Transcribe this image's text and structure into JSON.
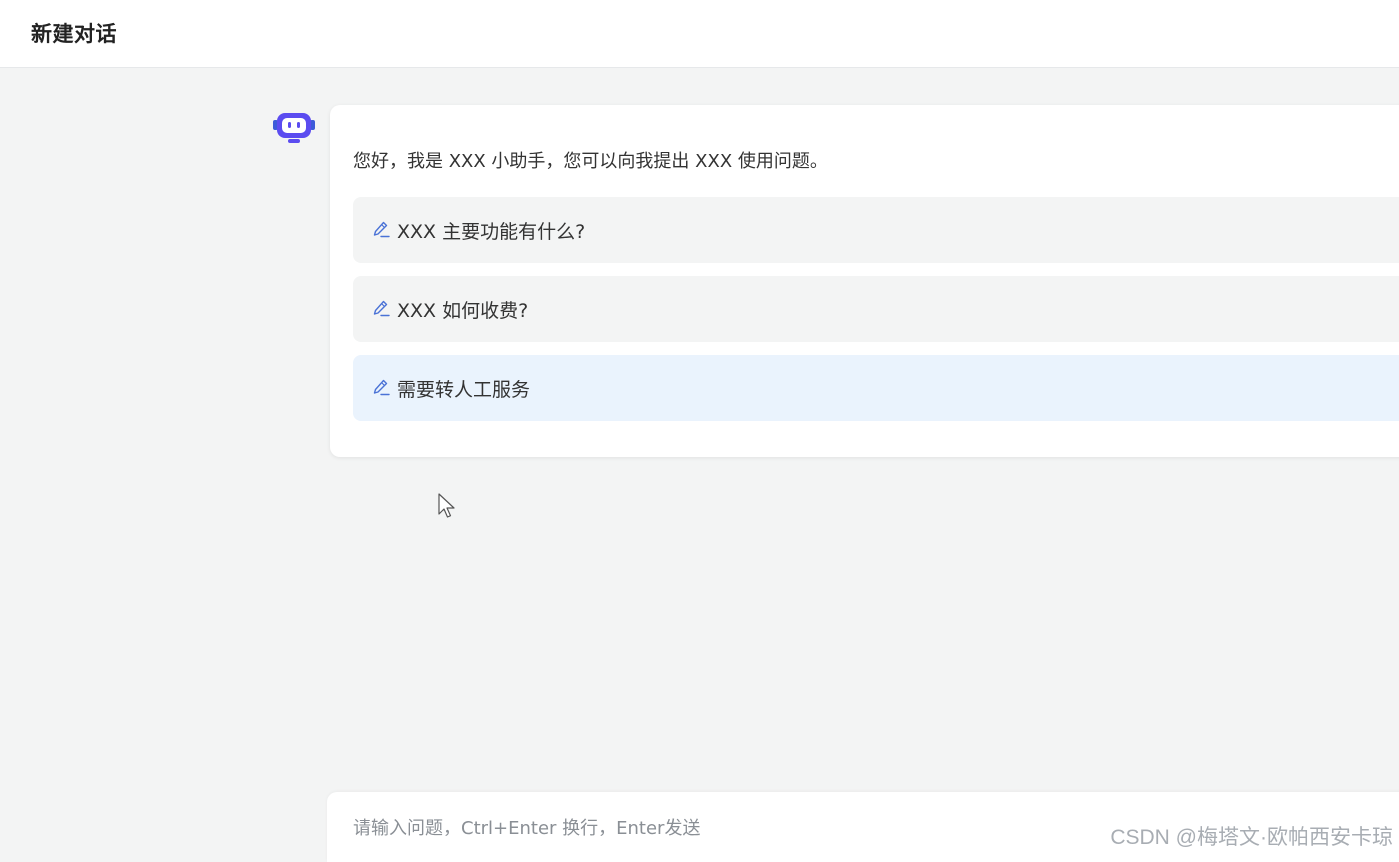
{
  "header": {
    "title": "新建对话"
  },
  "assistant": {
    "avatar_icon": "robot-icon",
    "greeting": "您好，我是 XXX 小助手，您可以向我提出 XXX 使用问题。",
    "suggestions": [
      {
        "label": "XXX 主要功能有什么?",
        "icon": "pencil-icon"
      },
      {
        "label": "XXX 如何收费?",
        "icon": "pencil-icon"
      },
      {
        "label": "需要转人工服务",
        "icon": "pencil-icon",
        "hovered": true
      }
    ]
  },
  "composer": {
    "placeholder": "请输入问题，Ctrl+Enter 换行，Enter发送",
    "value": ""
  },
  "watermark": "CSDN @梅塔文·欧帕西安卡琼",
  "colors": {
    "accent": "#5b4cf0",
    "icon_blue": "#4a72d6",
    "hover_bg": "#eaf3fd",
    "suggestion_bg": "#f3f4f4",
    "page_bg": "#f3f4f4"
  }
}
